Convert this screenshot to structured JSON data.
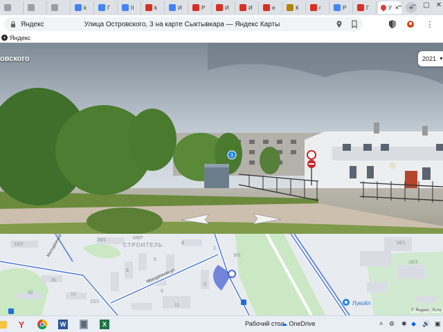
{
  "tabs": [
    {
      "label": "",
      "color": "#9aa0a6"
    },
    {
      "label": "",
      "color": "#9aa0a6"
    },
    {
      "label": "",
      "color": "#9aa0a6"
    },
    {
      "label": "k",
      "color": "#4285f4"
    },
    {
      "label": "Г",
      "color": "#4285f4"
    },
    {
      "label": "II",
      "color": "#4285f4"
    },
    {
      "label": "k",
      "color": "#d93025"
    },
    {
      "label": "И",
      "color": "#4285f4"
    },
    {
      "label": "Р",
      "color": "#d93025"
    },
    {
      "label": "И",
      "color": "#d93025"
    },
    {
      "label": "И",
      "color": "#d93025"
    },
    {
      "label": "е",
      "color": "#d93025"
    },
    {
      "label": "К",
      "color": "#b08400"
    },
    {
      "label": "г",
      "color": "#d93025"
    },
    {
      "label": "Р",
      "color": "#4285f4"
    },
    {
      "label": "Г",
      "color": "#d93025"
    }
  ],
  "active_tab": {
    "label": "У",
    "color": "#e53935"
  },
  "address": {
    "site": "Яндекс",
    "title": "Улица Островского, 3 на карте Сыктывкара — Яндекс Карты"
  },
  "bookmarks": {
    "label": "Яндекс"
  },
  "panorama": {
    "title": "овского",
    "year": "2021",
    "badge": "3"
  },
  "map": {
    "labels": {
      "district": "МКР",
      "district_name": "СТРОИТЕЛЬ",
      "street1": "Молодёжный пр.",
      "street2": "Молодёжная ул.",
      "store": "Лукойл",
      "copyright": "© Яндекс",
      "terms": "Усло",
      "h13": "13/2",
      "h28": "28/1",
      "h8": "8",
      "h6": "6",
      "h4": "4",
      "h3": "3",
      "h1": "1",
      "h31": "31",
      "h12": "12",
      "h12_1": "12/1",
      "h32": "32",
      "h8_1": "8/1",
      "h9": "9",
      "h11": "11",
      "h18": "18/1",
      "h18_3": "18/3"
    }
  },
  "taskbar": {
    "desktop": "Рабочий стол",
    "onedrive": "OneDrive"
  }
}
